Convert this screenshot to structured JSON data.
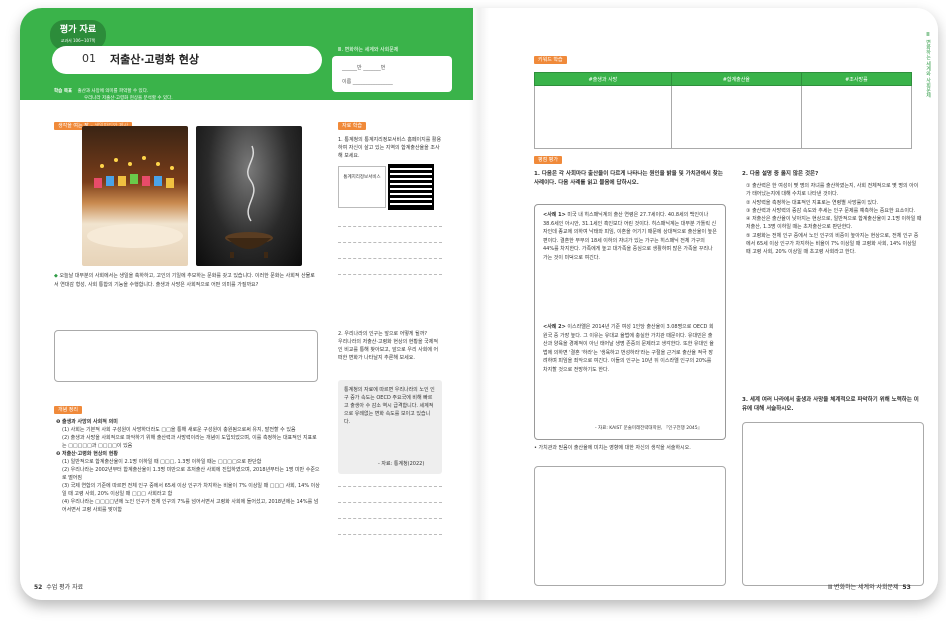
{
  "left_page": {
    "tag": {
      "label": "평가 자료",
      "sub": "교과서 106~107쪽"
    },
    "lesson_number": "01",
    "lesson_title": "저출산·고령화 현상",
    "unit_label": "Ⅲ. 변화하는 세계와 사회문제",
    "name_fields": {
      "row1": "______반 _______번",
      "row2": "이름 ________________"
    },
    "goals": {
      "label": "학습 목표",
      "items": [
        "출산과 사망에 의미를 파악할 수 있다.",
        "우리나라 저출산·고령화 현상을 분석할 수 있다."
      ]
    },
    "section_think": {
      "label": "생각을 여는 장",
      "sub": " – 생일파티와 제사"
    },
    "question_main": "오늘날 대부분의 사회에서는 생일을 축하하고, 고인의 기일에 추모하는 문화를 갖고 있습니다. 이러한 문화는 사회적 산물로서 연대감 형성, 사회 통합의 기능을 수행합니다. 출생과 사망은 사회적으로 어떤 의미를 가질까요?",
    "section_material": {
      "label": "자료 학습"
    },
    "material_1": "1. 통계청의 통계지리정보서비스 홈페이지를 활용하여 자신이 살고 있는 지역의 합계출산율을 조사해 보세요.",
    "qr_label": "통계지리정보서비스",
    "material_2": "2. 우리나라의 인구는 앞으로 어떻게 될까?",
    "material_2_body": "우리나라의 저출산·고령화 현상의 현황을 국제적인 비교를 통해 찾아보고, 앞으로 우리 사회에 어떠한 변화가 나타날지 추론해 보세요.",
    "gray_box": "통계청의 자료에 따르면 우리나라의 노인 인구 증가 속도는 OECD 주요국에 비해 빠르고 출생아 수 감소 역시 급격합니다. 세계적으로 유례없는 변화 속도를 보이고 있습니다.",
    "gray_source": "- 자료: 통계청(2022)",
    "section_concept": {
      "label": "개념 정리"
    },
    "concept_1_title": "❶ 출생과 사망의 사회적 의미",
    "concept_1_items": [
      "(1) 사회는 기본적 사회 구성원이 사망하더라도 □□을 통해 새로운 구성원이 충원됨으로써 유지, 발전할 수 있음",
      "(2) 출생과 사망을 사회적으로 파악하기 위해 출산력과 사망력이라는 개념이 도입되었으며, 이를 측정하는 대표적인 지표로는 □□□□□과 □□□□이 있음"
    ],
    "concept_2_title": "❷ 저출산·고령화 현상의 현황",
    "concept_2_items": [
      "(1) 일반적으로 합계출산율이 2.1명 이하일 때 □□□, 1.3명 이하일 때는 □□□□으로 판단함",
      "(2) 우리나라는 2002년부터 합계출산율이 1.3명 미만으로 초저출산 사회에 진입하였으며, 2018년부터는 1명 미만 수준으로 떨어짐",
      "(3) 국제 연합의 기준에 따르면 전체 인구 중에서 65세 이상 인구가 차지하는 비율이 7% 이상일 때 □□□ 사회, 14% 이상일 때 고령 사회, 20% 이상일 때 □□□ 사회라고 함",
      "(4) 우리나라는 □□□□년에 노인 인구가 전체 인구의 7%를 넘어서면서 고령화 사회에 들어섰고, 2018년에는 14%를 넘어서면서 고령 사회를 맞이함"
    ],
    "page_number": "52",
    "footer": "수업 평가 자료"
  },
  "right_page": {
    "sidebar_text": "Ⅲ 변화하는 세계와 사회문제",
    "section_keyword": {
      "label": "키워드 학습"
    },
    "table_headers": [
      "#출생과 사망",
      "#합계출산율",
      "#조사망률"
    ],
    "section_eval": {
      "label": "평점 평가"
    },
    "q1": "1. 다음은 각 사회마다 출산율이 다르게 나타나는 원인을 밝을 및 가치관에서 찾는 사례이다. 다음 사례를 읽고 물음에 답하시오.",
    "case1_title": "<사례 1>",
    "case1_body": "미국 내 히스패닉계의 출산 연령은 27.7세이다. 40.8세의 백인이나 38.6세인 아시안, 31.1세인 흑인보다 어린 것이다. 히스패닉계는 대부분 가톨릭 신자인데 종교에 의하여 낙태와 피임, 이혼을 어기기 때문에 상대적으로 출산율이 높은 편이다. 결혼한 부부의 18세 이하의 자녀가 있는 가구는 히스패닉 전체 가구의 44%를 차지한다. 가족에게 높고 대가족을 중심으로 생활하며 많은 가족을 꾸리나가는 것이 미덕으로 여긴다.",
    "case2_title": "<사례 2>",
    "case2_body": "이스라엘은 2014년 기준 여성 1인당 출산율이 3.08명으로 OECD 회원국 중 가장 높다. 그 이유는 유대교 율법에 충실한 가치관 때문이다. 유대민은 출산과 양육을 경제적이 아닌 태어날 생명 존중의 문제라고 생각한다. 또한 유대인 율법에 의하면 '결혼 '하라'는 '생육하고 번성하라'라는 구절을 근거로 출산율 적극 장려하며 피임을 죄악으로 여긴다. 이들의 인구는 10년 뒤 이스라엘 인구의 20%를 차지할 것으로 전망하기도 한다.",
    "case2_source": "- 자료: KAIST 문술미래전략대학원, 『인구전쟁 2045』",
    "q1_sub": "• 가치관과 믿음이 출산율에 미치는 영향에 대한 자신의 생각을 서술하시오.",
    "q2": "2. 다음 설명 중 옳지 않은 것은?",
    "q2_options": [
      "① 출산력은 한 여성이 몇 명의 자녀를 출산하였는지, 사회 전체적으로 몇 명의 아이가 태어났는지에 대해 수치로 나타낸 것이다.",
      "② 사망력을 측정하는 대표적인 지표로는 연령별 사망률이 있다.",
      "③ 출산력과 사망력의 증감 속도와 추세는 인구 문제를 예측하는 중요한 요소이다.",
      "④ 저출산은 출산율이 낮아지는 현상으로, 일반적으로 합계출산율이 2.1명 이하일 때 저출산, 1.3명 이하일 때는 초저출산으로 판단한다.",
      "⑤ 고령화는 전체 인구 중에서 노인 인구의 비중이 높아지는 현상으로, 전체 인구 중에서 65세 이상 인구가 차지하는 비율이 7% 이상일 때 고령화 사회, 14% 이상일 때 고령 사회, 20% 이상일 때 초고령 사회라고 한다."
    ],
    "q3": "3. 세계 여러 나라에서 출생과 사망을 체계적으로 파악하기 위해 노력하는 이유에 대해 서술하시오.",
    "page_number": "53",
    "footer": "Ⅲ 변화하는 세계와 사회문제"
  }
}
